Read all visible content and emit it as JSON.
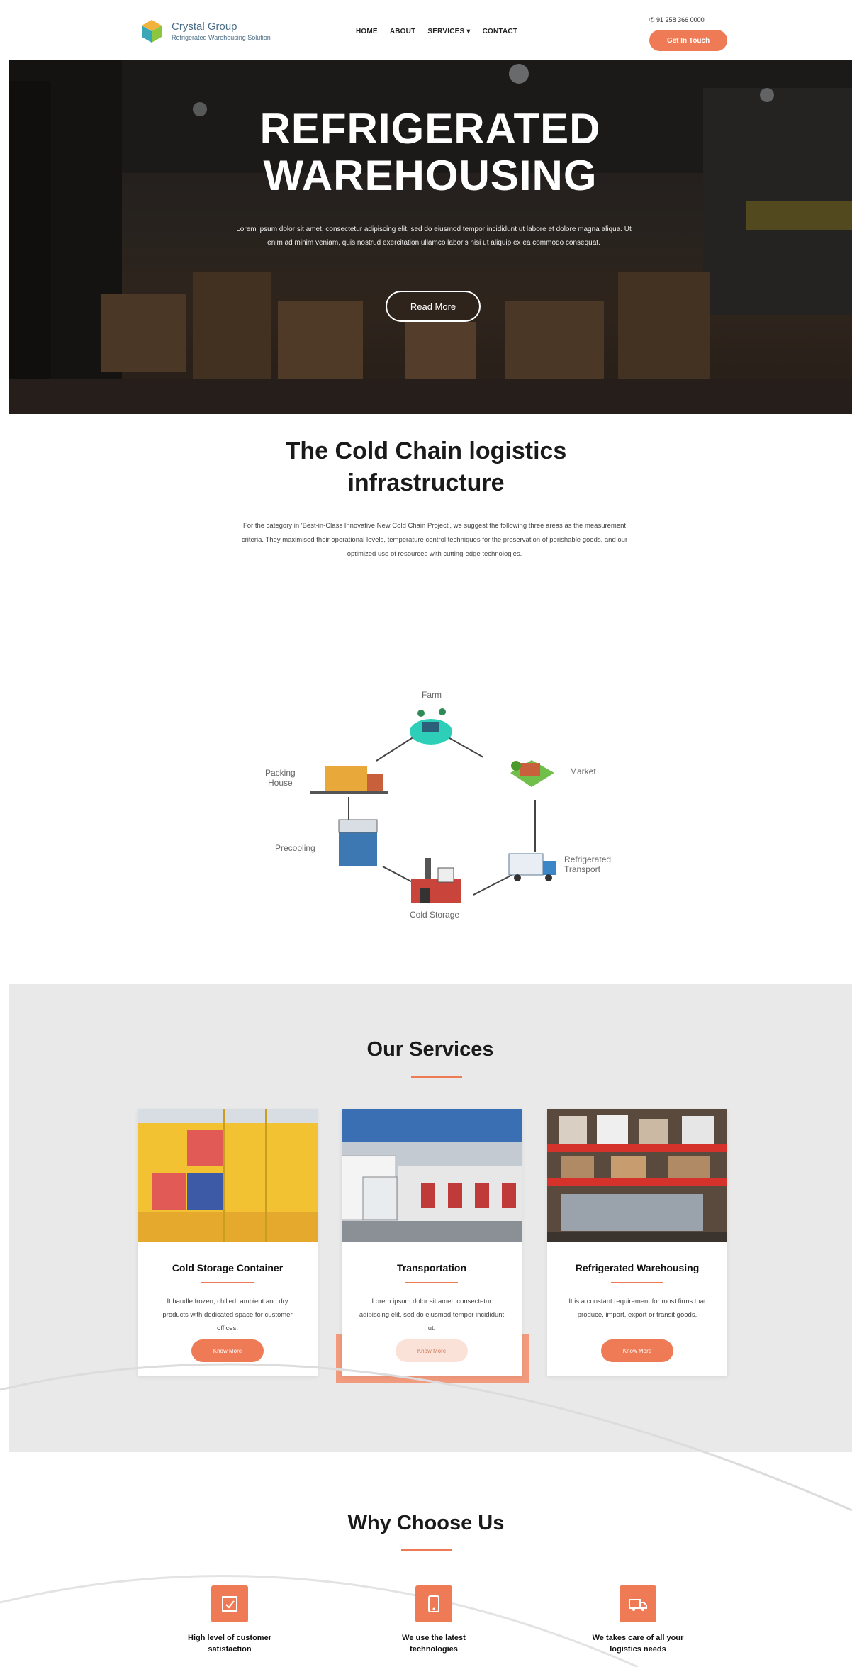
{
  "header": {
    "logo_name": "Crystal Group",
    "logo_tagline": "Refrigerated Warehousing Solution",
    "nav": [
      "HOME",
      "ABOUT",
      "SERVICES ▾",
      "CONTACT"
    ],
    "phone": "&#9990; 91 258 366 0000",
    "cta_label": "Get In Touch"
  },
  "hero": {
    "title_line1": "REFRIGERATED",
    "title_line2": "WAREHOUSING",
    "text": "Lorem ipsum dolor sit amet, consectetur adipiscing elit, sed do eiusmod tempor incididunt ut labore et dolore magna aliqua. Ut enim ad minim veniam, quis nostrud exercitation ullamco laboris nisi ut aliquip ex ea commodo consequat.",
    "button_label": "Read More"
  },
  "intro": {
    "title_line1": "The Cold Chain logistics",
    "title_line2": "infrastructure",
    "text": "For the category in 'Best-in-Class Innovative New Cold Chain Project', we suggest the following three areas as the measurement criteria. They maximised their operational levels, temperature control techniques for the preservation of perishable goods, and our optimized use of resources with cutting-edge technologies."
  },
  "diagram": {
    "nodes": {
      "farm": "Farm",
      "market": "Market",
      "transport_line1": "Refrigerated",
      "transport_line2": "Transport",
      "cold_storage": "Cold Storage",
      "precooling": "Precooling",
      "packing_line1": "Packing",
      "packing_line2": "House"
    }
  },
  "services": {
    "title": "Our Services",
    "cards": [
      {
        "title": "Cold Storage Container",
        "text": "It handle frozen, chilled, ambient and dry products with dedicated space for customer offices.",
        "button": "Know More"
      },
      {
        "title": "Transportation",
        "text": "Lorem ipsum dolor sit amet, consectetur adipiscing elit, sed do eiusmod tempor incididunt ut.",
        "button": "Know More"
      },
      {
        "title": "Refrigerated Warehousing",
        "text": "It is a constant requirement for most firms that produce, import, export or transit goods.",
        "button": "Know More"
      }
    ]
  },
  "why": {
    "title": "Why Choose Us",
    "items": [
      {
        "label_line1": "High level of customer",
        "label_line2": "satisfaction"
      },
      {
        "label_line1": "We use the latest",
        "label_line2": "technologies"
      },
      {
        "label_line1": "We takes care of all your",
        "label_line2": "logistics needs"
      }
    ]
  },
  "colors": {
    "accent": "#ee7b55",
    "services_bg": "#e9e9e9",
    "logo_text": "#4a6d85"
  }
}
